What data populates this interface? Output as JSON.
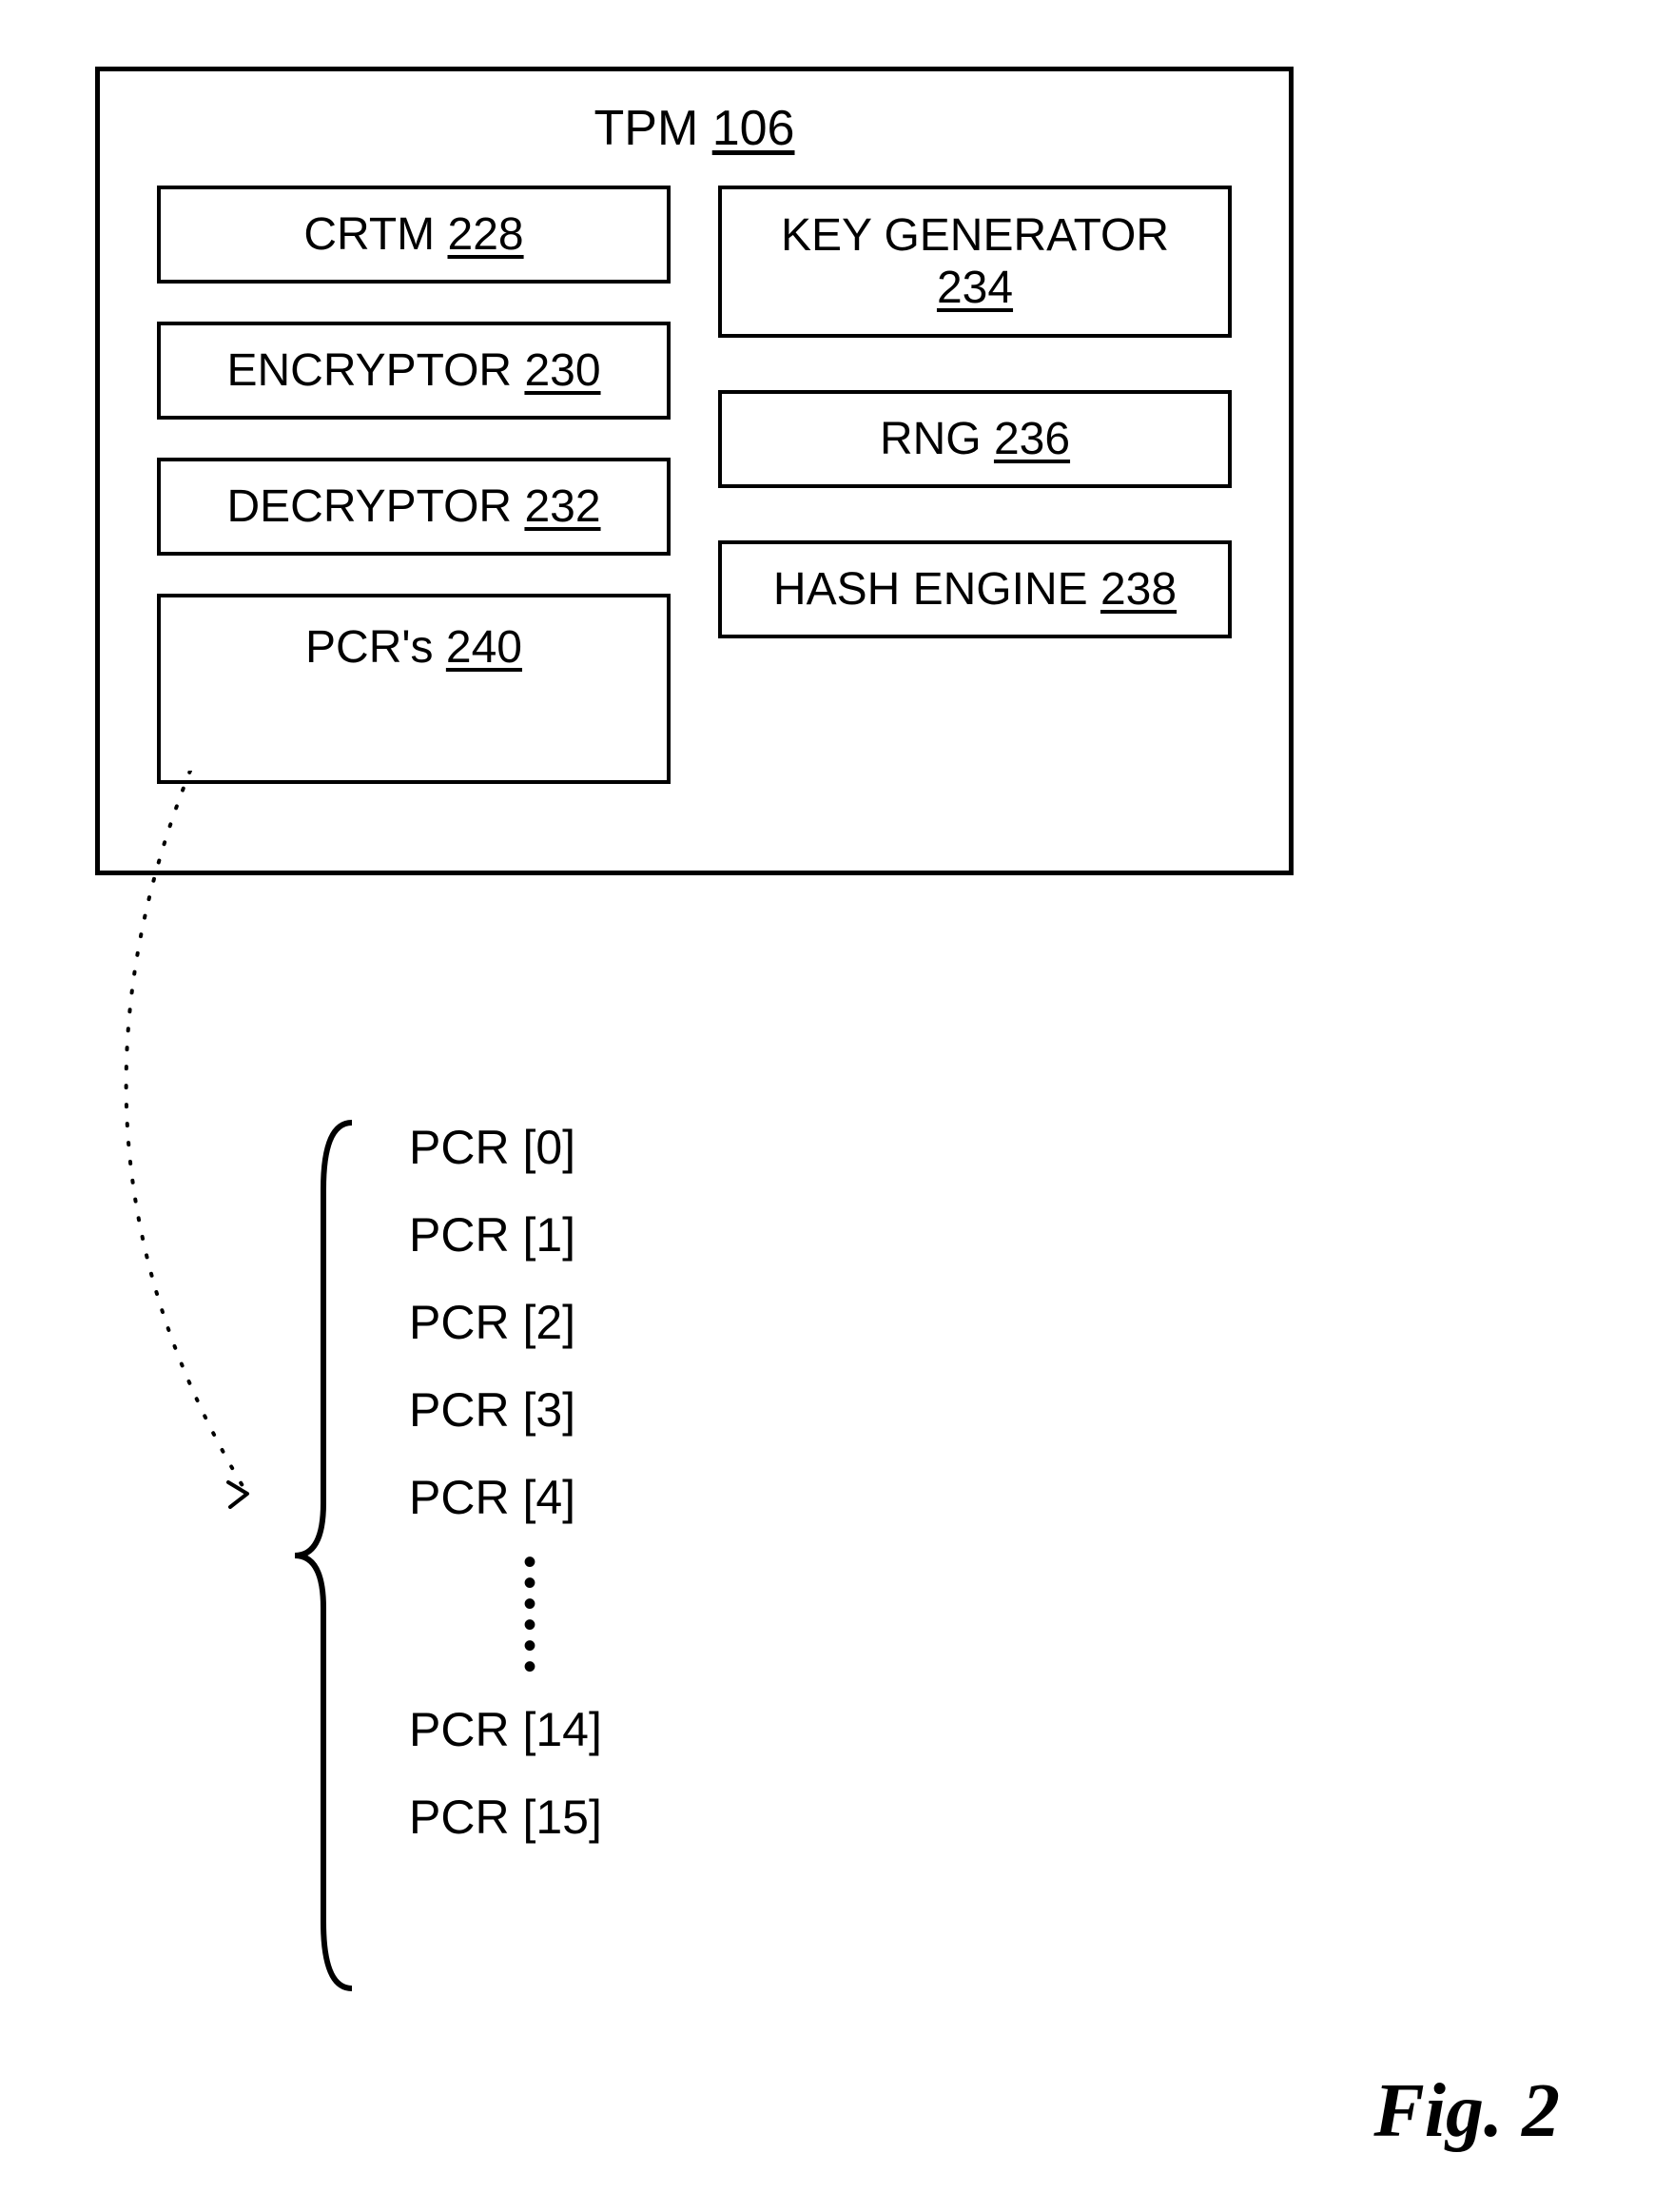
{
  "tpm": {
    "title_prefix": "TPM ",
    "title_num": "106",
    "left": [
      {
        "label": "CRTM ",
        "num": "228"
      },
      {
        "label": "ENCRYPTOR ",
        "num": "230"
      },
      {
        "label": "DECRYPTOR ",
        "num": "232"
      },
      {
        "label": "PCR's ",
        "num": "240"
      }
    ],
    "right": [
      {
        "label": "KEY GENERATOR",
        "num": "234"
      },
      {
        "label": "RNG ",
        "num": "236"
      },
      {
        "label": "HASH ENGINE ",
        "num": "238"
      }
    ]
  },
  "pcr_list": {
    "explicit_top": [
      "PCR [0]",
      "PCR [1]",
      "PCR [2]",
      "PCR [3]",
      "PCR [4]"
    ],
    "explicit_bottom": [
      "PCR [14]",
      "PCR [15]"
    ]
  },
  "figure_label": "Fig. 2"
}
